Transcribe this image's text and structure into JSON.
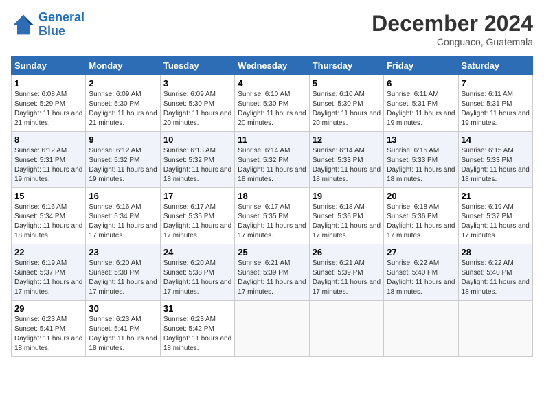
{
  "header": {
    "logo_line1": "General",
    "logo_line2": "Blue",
    "month": "December 2024",
    "location": "Conguaco, Guatemala"
  },
  "weekdays": [
    "Sunday",
    "Monday",
    "Tuesday",
    "Wednesday",
    "Thursday",
    "Friday",
    "Saturday"
  ],
  "weeks": [
    [
      {
        "day": "1",
        "sunrise": "Sunrise: 6:08 AM",
        "sunset": "Sunset: 5:29 PM",
        "daylight": "Daylight: 11 hours and 21 minutes."
      },
      {
        "day": "2",
        "sunrise": "Sunrise: 6:09 AM",
        "sunset": "Sunset: 5:30 PM",
        "daylight": "Daylight: 11 hours and 21 minutes."
      },
      {
        "day": "3",
        "sunrise": "Sunrise: 6:09 AM",
        "sunset": "Sunset: 5:30 PM",
        "daylight": "Daylight: 11 hours and 20 minutes."
      },
      {
        "day": "4",
        "sunrise": "Sunrise: 6:10 AM",
        "sunset": "Sunset: 5:30 PM",
        "daylight": "Daylight: 11 hours and 20 minutes."
      },
      {
        "day": "5",
        "sunrise": "Sunrise: 6:10 AM",
        "sunset": "Sunset: 5:30 PM",
        "daylight": "Daylight: 11 hours and 20 minutes."
      },
      {
        "day": "6",
        "sunrise": "Sunrise: 6:11 AM",
        "sunset": "Sunset: 5:31 PM",
        "daylight": "Daylight: 11 hours and 19 minutes."
      },
      {
        "day": "7",
        "sunrise": "Sunrise: 6:11 AM",
        "sunset": "Sunset: 5:31 PM",
        "daylight": "Daylight: 11 hours and 19 minutes."
      }
    ],
    [
      {
        "day": "8",
        "sunrise": "Sunrise: 6:12 AM",
        "sunset": "Sunset: 5:31 PM",
        "daylight": "Daylight: 11 hours and 19 minutes."
      },
      {
        "day": "9",
        "sunrise": "Sunrise: 6:12 AM",
        "sunset": "Sunset: 5:32 PM",
        "daylight": "Daylight: 11 hours and 19 minutes."
      },
      {
        "day": "10",
        "sunrise": "Sunrise: 6:13 AM",
        "sunset": "Sunset: 5:32 PM",
        "daylight": "Daylight: 11 hours and 18 minutes."
      },
      {
        "day": "11",
        "sunrise": "Sunrise: 6:14 AM",
        "sunset": "Sunset: 5:32 PM",
        "daylight": "Daylight: 11 hours and 18 minutes."
      },
      {
        "day": "12",
        "sunrise": "Sunrise: 6:14 AM",
        "sunset": "Sunset: 5:33 PM",
        "daylight": "Daylight: 11 hours and 18 minutes."
      },
      {
        "day": "13",
        "sunrise": "Sunrise: 6:15 AM",
        "sunset": "Sunset: 5:33 PM",
        "daylight": "Daylight: 11 hours and 18 minutes."
      },
      {
        "day": "14",
        "sunrise": "Sunrise: 6:15 AM",
        "sunset": "Sunset: 5:33 PM",
        "daylight": "Daylight: 11 hours and 18 minutes."
      }
    ],
    [
      {
        "day": "15",
        "sunrise": "Sunrise: 6:16 AM",
        "sunset": "Sunset: 5:34 PM",
        "daylight": "Daylight: 11 hours and 18 minutes."
      },
      {
        "day": "16",
        "sunrise": "Sunrise: 6:16 AM",
        "sunset": "Sunset: 5:34 PM",
        "daylight": "Daylight: 11 hours and 17 minutes."
      },
      {
        "day": "17",
        "sunrise": "Sunrise: 6:17 AM",
        "sunset": "Sunset: 5:35 PM",
        "daylight": "Daylight: 11 hours and 17 minutes."
      },
      {
        "day": "18",
        "sunrise": "Sunrise: 6:17 AM",
        "sunset": "Sunset: 5:35 PM",
        "daylight": "Daylight: 11 hours and 17 minutes."
      },
      {
        "day": "19",
        "sunrise": "Sunrise: 6:18 AM",
        "sunset": "Sunset: 5:36 PM",
        "daylight": "Daylight: 11 hours and 17 minutes."
      },
      {
        "day": "20",
        "sunrise": "Sunrise: 6:18 AM",
        "sunset": "Sunset: 5:36 PM",
        "daylight": "Daylight: 11 hours and 17 minutes."
      },
      {
        "day": "21",
        "sunrise": "Sunrise: 6:19 AM",
        "sunset": "Sunset: 5:37 PM",
        "daylight": "Daylight: 11 hours and 17 minutes."
      }
    ],
    [
      {
        "day": "22",
        "sunrise": "Sunrise: 6:19 AM",
        "sunset": "Sunset: 5:37 PM",
        "daylight": "Daylight: 11 hours and 17 minutes."
      },
      {
        "day": "23",
        "sunrise": "Sunrise: 6:20 AM",
        "sunset": "Sunset: 5:38 PM",
        "daylight": "Daylight: 11 hours and 17 minutes."
      },
      {
        "day": "24",
        "sunrise": "Sunrise: 6:20 AM",
        "sunset": "Sunset: 5:38 PM",
        "daylight": "Daylight: 11 hours and 17 minutes."
      },
      {
        "day": "25",
        "sunrise": "Sunrise: 6:21 AM",
        "sunset": "Sunset: 5:39 PM",
        "daylight": "Daylight: 11 hours and 17 minutes."
      },
      {
        "day": "26",
        "sunrise": "Sunrise: 6:21 AM",
        "sunset": "Sunset: 5:39 PM",
        "daylight": "Daylight: 11 hours and 17 minutes."
      },
      {
        "day": "27",
        "sunrise": "Sunrise: 6:22 AM",
        "sunset": "Sunset: 5:40 PM",
        "daylight": "Daylight: 11 hours and 18 minutes."
      },
      {
        "day": "28",
        "sunrise": "Sunrise: 6:22 AM",
        "sunset": "Sunset: 5:40 PM",
        "daylight": "Daylight: 11 hours and 18 minutes."
      }
    ],
    [
      {
        "day": "29",
        "sunrise": "Sunrise: 6:23 AM",
        "sunset": "Sunset: 5:41 PM",
        "daylight": "Daylight: 11 hours and 18 minutes."
      },
      {
        "day": "30",
        "sunrise": "Sunrise: 6:23 AM",
        "sunset": "Sunset: 5:41 PM",
        "daylight": "Daylight: 11 hours and 18 minutes."
      },
      {
        "day": "31",
        "sunrise": "Sunrise: 6:23 AM",
        "sunset": "Sunset: 5:42 PM",
        "daylight": "Daylight: 11 hours and 18 minutes."
      },
      null,
      null,
      null,
      null
    ]
  ]
}
